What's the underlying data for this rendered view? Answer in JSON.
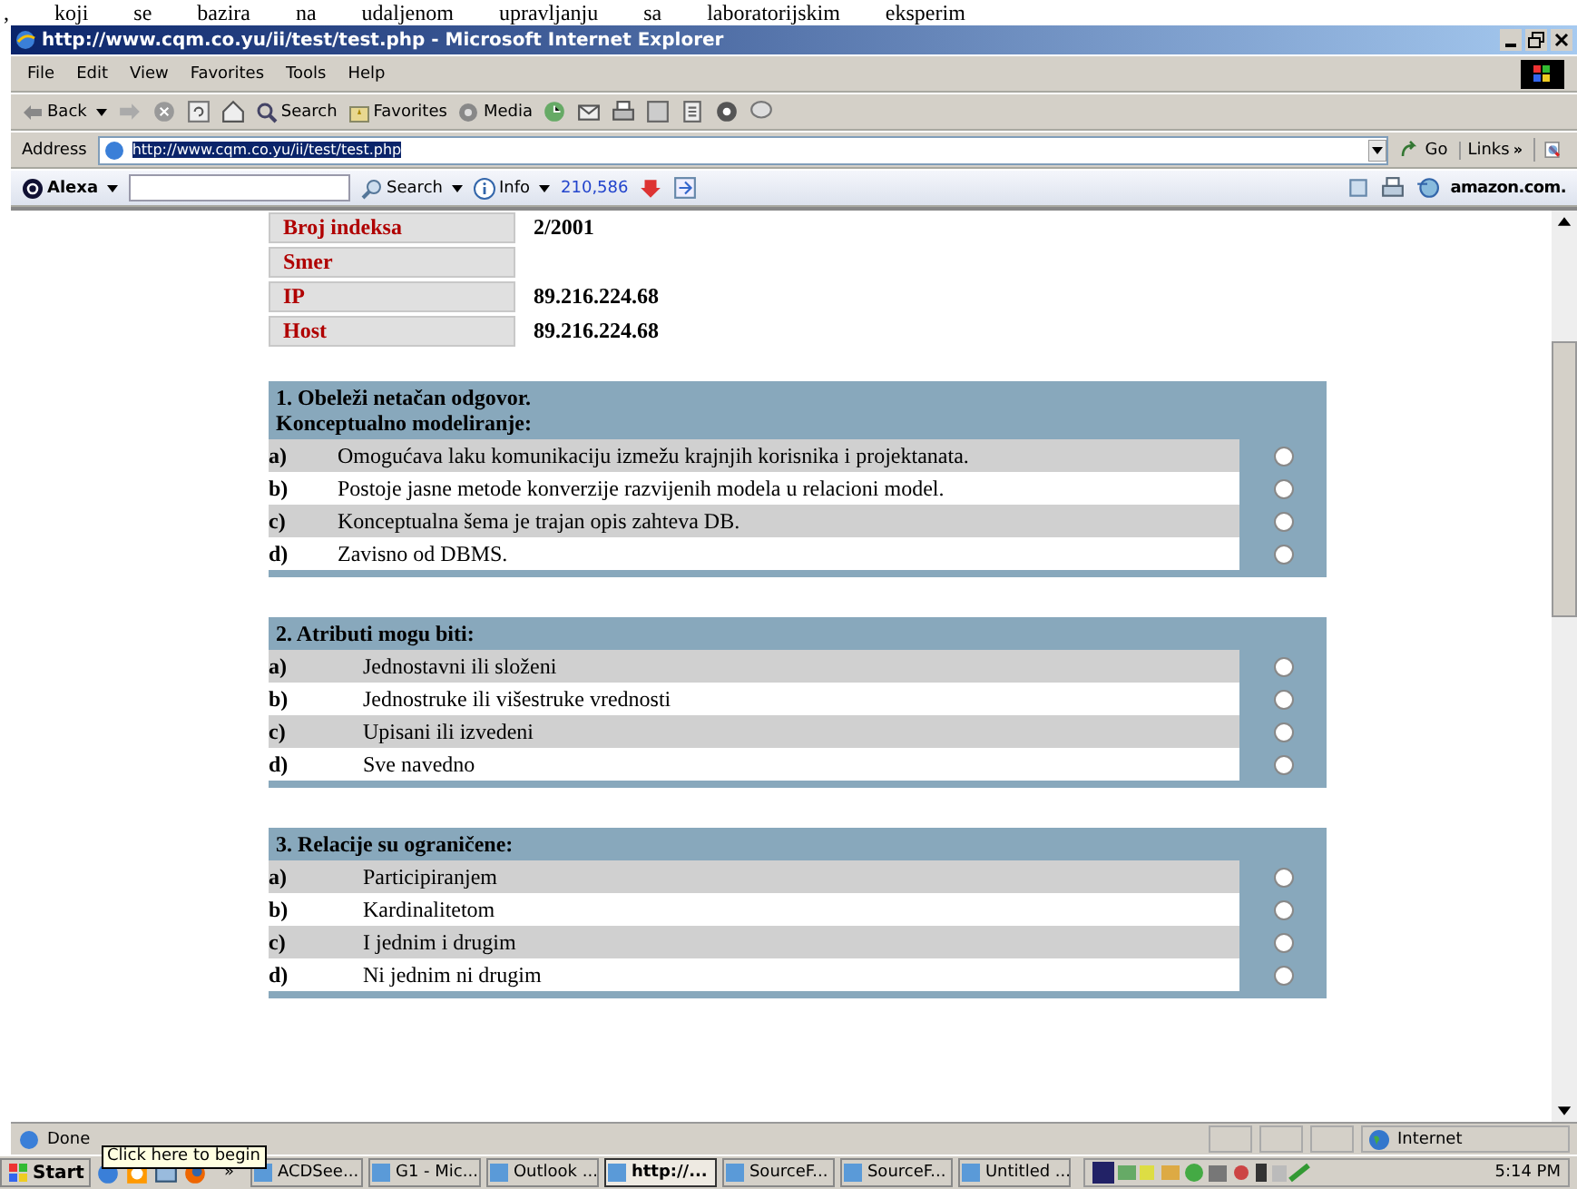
{
  "document_text": ", koji se bazira na udaljenom upravljanju sa laboratorijskim eksperim",
  "window": {
    "title": "http://www.cqm.co.yu/ii/test/test.php - Microsoft Internet Explorer"
  },
  "menu": [
    "File",
    "Edit",
    "View",
    "Favorites",
    "Tools",
    "Help"
  ],
  "toolbar": {
    "back": "Back",
    "search": "Search",
    "favorites": "Favorites",
    "media": "Media"
  },
  "address": {
    "label": "Address",
    "value": "http://www.cqm.co.yu/ii/test/test.php",
    "go": "Go",
    "links": "Links",
    "links_more": "»"
  },
  "alexa": {
    "brand": "Alexa",
    "search": "Search",
    "info": "Info",
    "rank": "210,586",
    "amazon": "amazon.com."
  },
  "info_table": [
    {
      "label": "Broj indeksa",
      "value": "2/2001"
    },
    {
      "label": "Smer"
    },
    {
      "label": "IP",
      "value": "89.216.224.68"
    },
    {
      "label": "Host",
      "value": "89.216.224.68"
    }
  ],
  "questions": [
    {
      "title": [
        "1. Obeleži netačan odgovor.",
        "Konceptualno modeliranje:"
      ],
      "options": [
        {
          "letter": "a)",
          "text": "Omogućava laku komunikaciju izmežu krajnjih korisnika i projektanata.",
          "selected": false
        },
        {
          "letter": "b)",
          "text": "Postoje jasne metode konverzije razvijenih modela u relacioni model.",
          "selected": false
        },
        {
          "letter": "c)",
          "text": "Konceptualna šema je trajan opis zahteva DB.",
          "selected": false
        },
        {
          "letter": "d)",
          "text": "Zavisno od DBMS.",
          "selected": false
        }
      ]
    },
    {
      "title": [
        "2. Atributi mogu biti:"
      ],
      "options": [
        {
          "letter": "a)",
          "text": "Jednostavni ili složeni",
          "selected": false
        },
        {
          "letter": "b)",
          "text": "Jednostruke ili višestruke vrednosti",
          "selected": false
        },
        {
          "letter": "c)",
          "text": "Upisani ili izvedeni",
          "selected": false
        },
        {
          "letter": "d)",
          "text": "Sve navedno",
          "selected": false
        }
      ]
    },
    {
      "title": [
        "3. Relacije su ograničene:"
      ],
      "options": [
        {
          "letter": "a)",
          "text": "Participiranjem",
          "selected": false
        },
        {
          "letter": "b)",
          "text": "Kardinalitetom",
          "selected": false
        },
        {
          "letter": "c)",
          "text": "I jednim i drugim",
          "selected": false
        },
        {
          "letter": "d)",
          "text": "Ni jednim ni drugim",
          "selected": false
        }
      ]
    }
  ],
  "status_bar": {
    "text": "Done",
    "zone": "Internet"
  },
  "tooltip": "Click here to begin",
  "taskbar": {
    "start": "Start",
    "more": "»",
    "tasks": [
      {
        "label": "ACDSee...",
        "selected": false
      },
      {
        "label": "G1 - Mic...",
        "selected": false
      },
      {
        "label": "Outlook ...",
        "selected": false
      },
      {
        "label": "http://...",
        "selected": true
      },
      {
        "label": "SourceF...",
        "selected": false
      },
      {
        "label": "SourceF...",
        "selected": false
      },
      {
        "label": "Untitled ...",
        "selected": false
      }
    ],
    "clock": "5:14 PM"
  }
}
